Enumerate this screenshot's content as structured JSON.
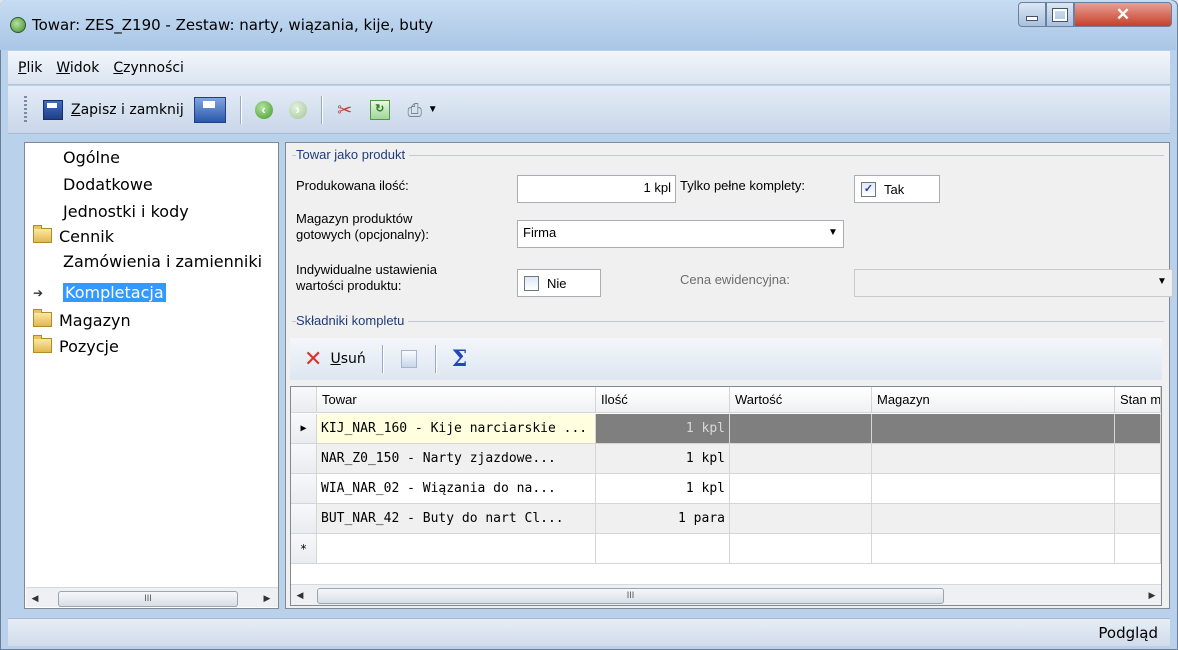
{
  "window": {
    "title": "Towar: ZES_Z190 - Zestaw: narty, wiązania, kije, buty"
  },
  "menu": [
    "Plik",
    "Widok",
    "Czynności"
  ],
  "toolbar": {
    "save_close": "Zapisz i zamknij"
  },
  "nav": {
    "items": [
      {
        "label": "Ogólne",
        "folder": false
      },
      {
        "label": "Dodatkowe",
        "folder": false
      },
      {
        "label": "Jednostki i kody",
        "folder": false
      },
      {
        "label": "Cennik",
        "folder": true
      },
      {
        "label": "Zamówienia i zamienniki",
        "folder": false
      },
      {
        "label": "Kompletacja",
        "folder": false,
        "selected": true
      },
      {
        "label": "Magazyn",
        "folder": true
      },
      {
        "label": "Pozycje",
        "folder": true
      }
    ]
  },
  "product": {
    "group_title": "Towar jako produkt",
    "qty_label": "Produkowana ilość:",
    "qty_value": "1 kpl",
    "full_sets_label": "Tylko pełne komplety:",
    "full_sets_value": "Tak",
    "full_sets_checked": true,
    "warehouse_label_1": "Magazyn produktów",
    "warehouse_label_2": "gotowych (opcjonalny):",
    "warehouse_value": "Firma",
    "individual_label_1": "Indywidualne ustawienia",
    "individual_label_2": "wartości produktu:",
    "individual_value": "Nie",
    "individual_checked": false,
    "price_label": "Cena ewidencyjna:",
    "price_value": ""
  },
  "components": {
    "group_title": "Składniki kompletu",
    "toolbar": {
      "delete": "Usuń"
    },
    "columns": [
      "Towar",
      "Ilość",
      "Wartość",
      "Magazyn",
      "Stan m"
    ],
    "rows": [
      {
        "towar": "KIJ_NAR_160 - Kije narciarskie ...",
        "ilosc": "1 kpl",
        "wartosc": "",
        "magazyn": "",
        "stan": ""
      },
      {
        "towar": "NAR_Z0_150 - Narty zjazdowe...",
        "ilosc": "1 kpl",
        "wartosc": "",
        "magazyn": "",
        "stan": ""
      },
      {
        "towar": "WIA_NAR_02 - Wiązania do na...",
        "ilosc": "1 kpl",
        "wartosc": "",
        "magazyn": "",
        "stan": ""
      },
      {
        "towar": "BUT_NAR_42 - Buty do nart Cl...",
        "ilosc": "1 para",
        "wartosc": "",
        "magazyn": "",
        "stan": ""
      }
    ]
  },
  "status": {
    "text": "Podgląd"
  },
  "colors": {
    "selection": "#3399ff",
    "title_bar": "#b9d1ea",
    "selected_row": "#7f7f7f"
  }
}
